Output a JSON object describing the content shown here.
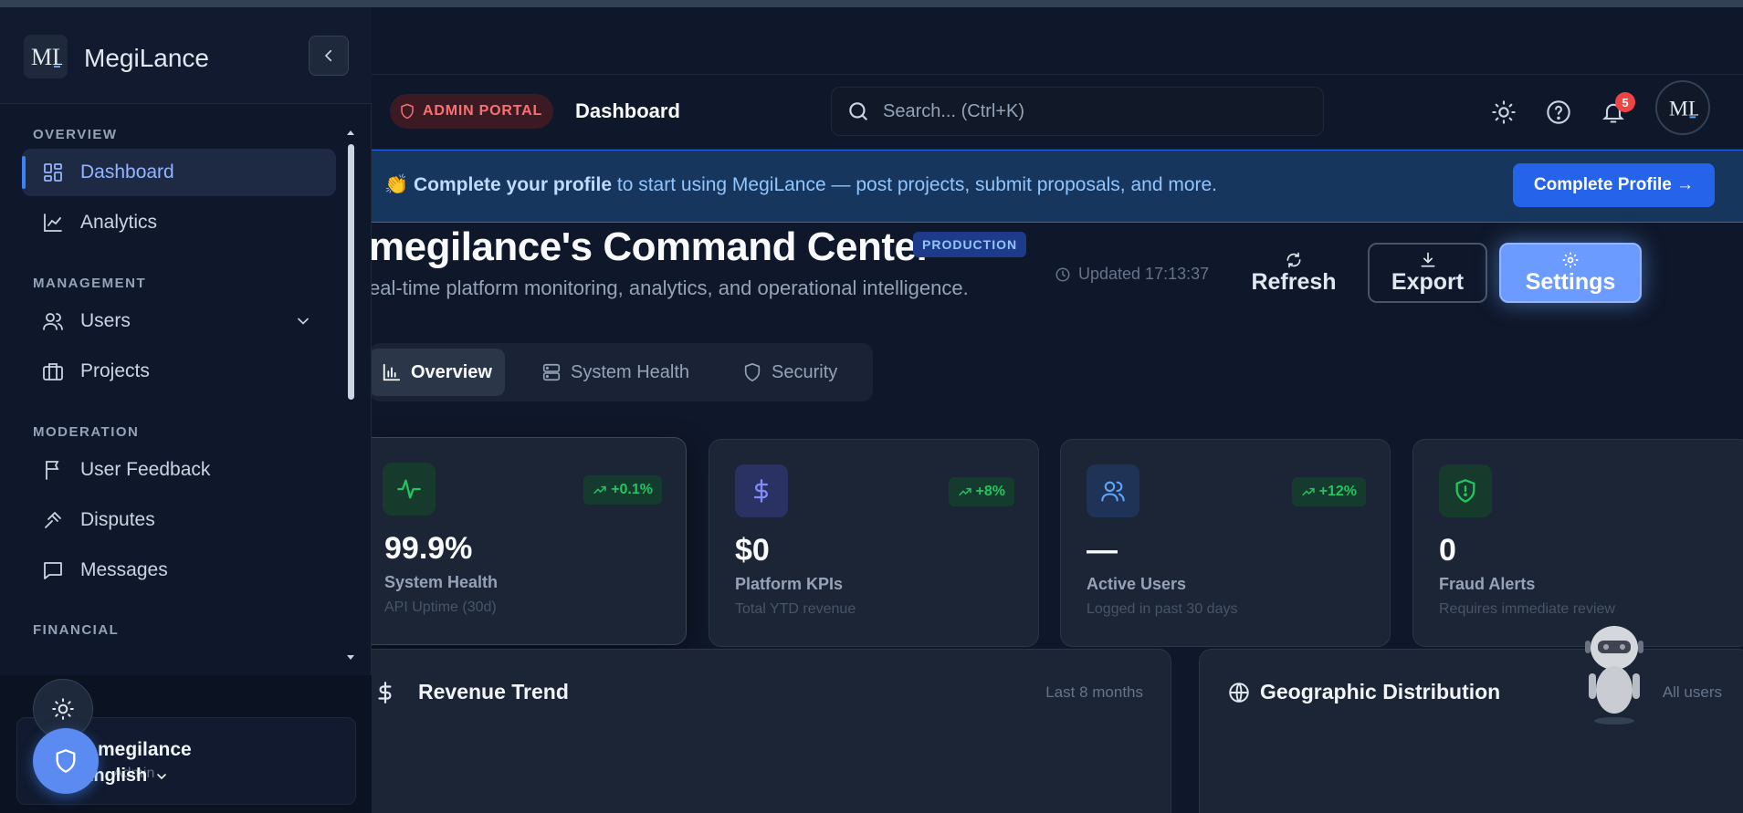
{
  "brand": {
    "name": "MegiLance",
    "logo_text": "ML"
  },
  "sidebar": {
    "sections": [
      {
        "title": "OVERVIEW"
      },
      {
        "title": "MANAGEMENT"
      },
      {
        "title": "MODERATION"
      },
      {
        "title": "FINANCIAL"
      }
    ],
    "items": [
      {
        "label": "Dashboard",
        "icon": "layout-grid-icon",
        "active": true
      },
      {
        "label": "Analytics",
        "icon": "line-chart-icon"
      },
      {
        "label": "Users",
        "icon": "users-icon",
        "expandable": true
      },
      {
        "label": "Projects",
        "icon": "briefcase-icon"
      },
      {
        "label": "User Feedback",
        "icon": "flag-icon"
      },
      {
        "label": "Disputes",
        "icon": "gavel-icon"
      },
      {
        "label": "Messages",
        "icon": "message-square-icon"
      }
    ],
    "user": {
      "name": "megilance",
      "role": "Admin",
      "language": "English"
    }
  },
  "header": {
    "badge": "ADMIN PORTAL",
    "title": "Dashboard",
    "search_placeholder": "Search... (Ctrl+K)",
    "notifications": "5"
  },
  "banner": {
    "emoji": "👏",
    "bold": "Complete your profile",
    "text": " to start using MegiLance — post projects, submit proposals, and more.",
    "button": "Complete Profile →"
  },
  "page": {
    "title": "megilance's Command Center",
    "env_badge": "PRODUCTION",
    "subtitle": "eal-time platform monitoring, analytics, and operational intelligence.",
    "updated": "Updated 17:13:37",
    "actions": {
      "refresh": "Refresh",
      "export": "Export",
      "settings": "Settings"
    }
  },
  "tabs": [
    {
      "label": "Overview",
      "active": true
    },
    {
      "label": "System Health"
    },
    {
      "label": "Security"
    }
  ],
  "kpis": [
    {
      "value": "99.9%",
      "label": "System Health",
      "sub": "API Uptime (30d)",
      "trend": "+0.1%",
      "icon": "activity-icon",
      "color": "#22c55e"
    },
    {
      "value": "$0",
      "label": "Platform KPIs",
      "sub": "Total YTD revenue",
      "trend": "+8%",
      "icon": "dollar-icon",
      "color": "#818cf8"
    },
    {
      "value": "—",
      "label": "Active Users",
      "sub": "Logged in past 30 days",
      "trend": "+12%",
      "icon": "users-icon",
      "color": "#60a5fa"
    },
    {
      "value": "0",
      "label": "Fraud Alerts",
      "sub": "Requires immediate review",
      "icon": "shield-alert-icon",
      "color": "#22c55e"
    }
  ],
  "panels": [
    {
      "title": "Revenue Trend",
      "meta": "Last 8 months",
      "icon": "dollar-icon"
    },
    {
      "title": "Geographic Distribution",
      "meta": "All users",
      "icon": "globe-icon"
    }
  ],
  "colors": {
    "accent": "#3b82f6",
    "bg": "#0f172a",
    "card": "#1c2536",
    "danger": "#ef4444",
    "success": "#22c55e"
  }
}
